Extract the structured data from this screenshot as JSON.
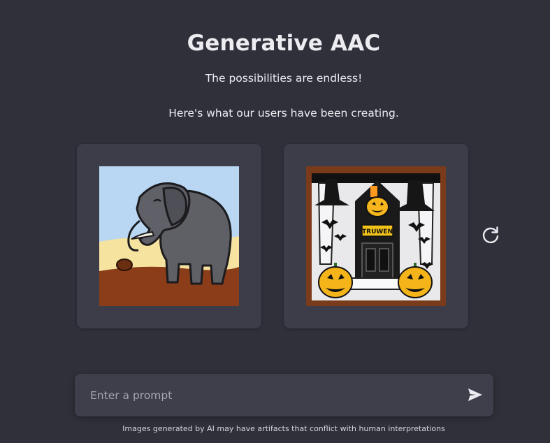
{
  "header": {
    "title": "Generative AAC",
    "tagline": "The possibilities are endless!",
    "showcase_text": "Here's what our users have been creating."
  },
  "gallery": {
    "items": [
      {
        "subject": "elephant"
      },
      {
        "subject": "halloween house with jack-o-lanterns",
        "sign_text": "TRUWEN"
      }
    ],
    "refresh_icon": "refresh-icon"
  },
  "prompt": {
    "placeholder": "Enter a prompt",
    "value": "",
    "send_icon": "send-icon"
  },
  "footer": {
    "disclaimer": "Images generated by AI may have artifacts that conflict with human interpretations"
  },
  "colors": {
    "background": "#30303a",
    "card": "#3d3d49",
    "input": "#3e3f4b",
    "text": "#ececf1"
  }
}
